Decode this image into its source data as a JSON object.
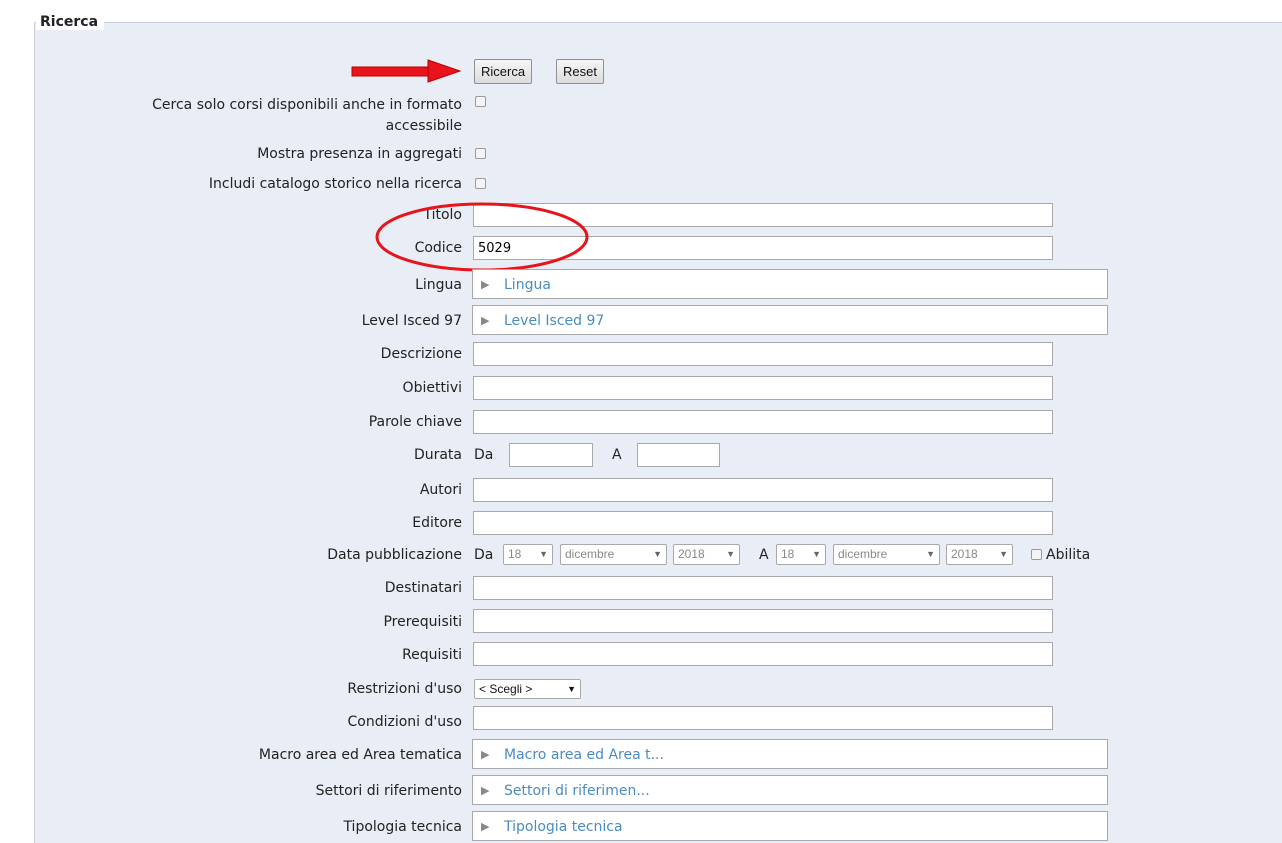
{
  "fieldset": {
    "legend": "Ricerca"
  },
  "buttons": {
    "search": "Ricerca",
    "reset": "Reset"
  },
  "options": {
    "accessible": "Cerca solo corsi disponibili anche in formato\naccessibile",
    "aggregates": "Mostra presenza in aggregati",
    "historical": "Includi catalogo storico nella ricerca"
  },
  "fields": {
    "titolo": {
      "label": "Titolo",
      "value": ""
    },
    "codice": {
      "label": "Codice",
      "value": "5029"
    },
    "lingua": {
      "label": "Lingua",
      "value": "Lingua"
    },
    "level": {
      "label": "Level Isced 97",
      "value": "Level Isced 97"
    },
    "descrizione": {
      "label": "Descrizione",
      "value": ""
    },
    "obiettivi": {
      "label": "Obiettivi",
      "value": ""
    },
    "parole": {
      "label": "Parole chiave",
      "value": ""
    },
    "durata": {
      "label": "Durata",
      "from_label": "Da",
      "to_label": "A",
      "from": "",
      "to": ""
    },
    "autori": {
      "label": "Autori",
      "value": ""
    },
    "editore": {
      "label": "Editore",
      "value": ""
    },
    "data_pub": {
      "label": "Data pubblicazione",
      "from_label": "Da",
      "to_label": "A",
      "from_day": "18",
      "from_month": "dicembre",
      "from_year": "2018",
      "to_day": "18",
      "to_month": "dicembre",
      "to_year": "2018",
      "enable_label": "Abilita"
    },
    "destinatari": {
      "label": "Destinatari",
      "value": ""
    },
    "prerequisiti": {
      "label": "Prerequisiti",
      "value": ""
    },
    "requisiti": {
      "label": "Requisiti",
      "value": ""
    },
    "restrizioni": {
      "label": "Restrizioni d'uso",
      "value": "< Scegli >"
    },
    "condizioni": {
      "label": "Condizioni d'uso",
      "value": ""
    },
    "macro_area": {
      "label": "Macro area ed Area tematica",
      "value": "Macro area ed Area t..."
    },
    "settori": {
      "label": "Settori di riferimento",
      "value": "Settori di riferimen..."
    },
    "tipologia": {
      "label": "Tipologia tecnica",
      "value": "Tipologia tecnica"
    }
  },
  "icons": {
    "expand": "triangle-right-icon",
    "dropdown": "chevron-down-icon"
  },
  "annotation_colors": {
    "arrow": "#e8141b",
    "ellipse": "#e8141b"
  }
}
